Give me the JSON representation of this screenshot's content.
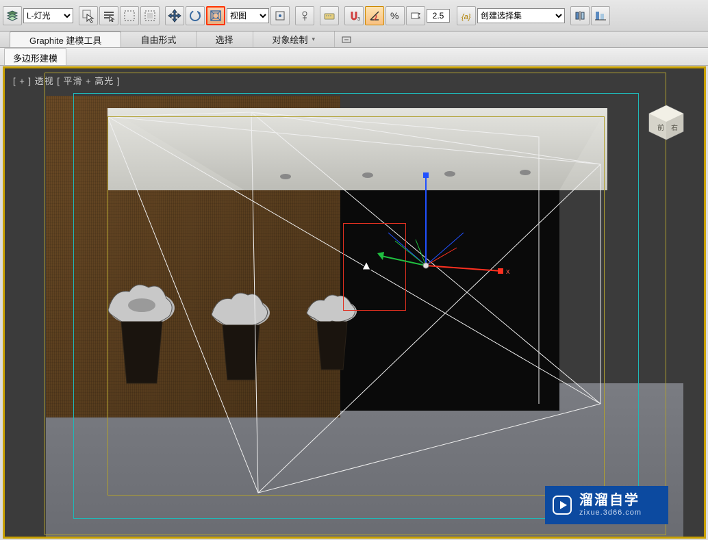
{
  "toolbar": {
    "filter_dropdown": "L-灯光",
    "view_dropdown": "视图",
    "spinner_value": "2.5",
    "selection_set": "创建选择集"
  },
  "ribbon": {
    "tabs": [
      "Graphite 建模工具",
      "自由形式",
      "选择",
      "对象绘制"
    ]
  },
  "subribbon": {
    "tabs": [
      "多边形建模"
    ]
  },
  "viewport": {
    "label": "[ + ] 透视 [ 平滑 + 高光 ]"
  },
  "watermark": {
    "title": "溜溜自学",
    "url": "zixue.3d66.com"
  },
  "icons": {
    "layers": "layers-icon",
    "cursor": "select-object-icon",
    "filter": "select-name-icon",
    "rect": "rectangular-selection-icon",
    "window": "window-crossing-icon",
    "move": "move-icon",
    "rotate": "rotate-icon",
    "scale": "scale-icon",
    "ref": "reference-coord-icon",
    "center": "use-pivot-icon",
    "mirror": "mirror-icon",
    "align": "align-icon",
    "layer": "manage-layers-icon",
    "curve": "curve-editor-icon",
    "schematic": "schematic-icon",
    "material": "material-editor-icon",
    "render_setup": "render-setup-icon",
    "render_frame": "rendered-frame-icon",
    "render": "render-icon",
    "snap": "snap-icon",
    "angle": "angle-snap-icon",
    "percent": "percent-snap-icon",
    "spinner": "spinner-snap-icon"
  }
}
